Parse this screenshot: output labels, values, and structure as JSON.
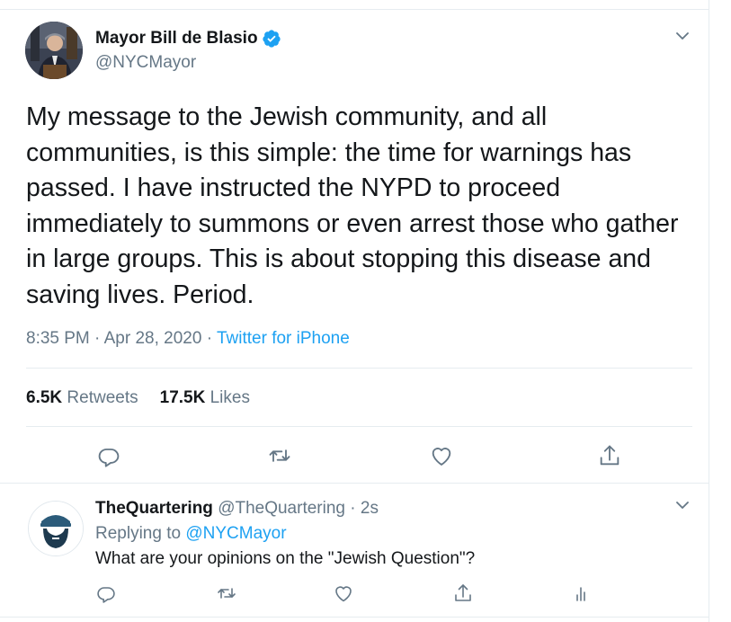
{
  "tweet": {
    "author_name": "Mayor Bill de Blasio",
    "author_handle": "@NYCMayor",
    "text": "My message to the Jewish community, and all communities, is this simple: the time for warnings has passed. I have instructed the NYPD to proceed immediately to summons or even arrest those who gather in large groups. This is about stopping this disease and saving lives. Period.",
    "time": "8:35 PM",
    "separator": "·",
    "date": "Apr 28, 2020",
    "source": "Twitter for iPhone",
    "retweets_count": "6.5K",
    "retweets_label": "Retweets",
    "likes_count": "17.5K",
    "likes_label": "Likes"
  },
  "reply": {
    "author_name": "TheQuartering",
    "author_handle": "@TheQuartering",
    "separator": "·",
    "time_ago": "2s",
    "replying_prefix": "Replying to",
    "replying_handle": "@NYCMayor",
    "text": "What are your opinions on the \"Jewish Question\"?"
  },
  "colors": {
    "text": "#14171a",
    "secondary": "#657786",
    "accent": "#1da1f2",
    "divider": "#e6ecf0"
  },
  "icons": {
    "verified": "verified-badge-icon",
    "chevron": "chevron-down-icon",
    "reply": "reply-icon",
    "retweet": "retweet-icon",
    "like": "heart-icon",
    "share": "share-icon",
    "analytics": "analytics-icon"
  }
}
